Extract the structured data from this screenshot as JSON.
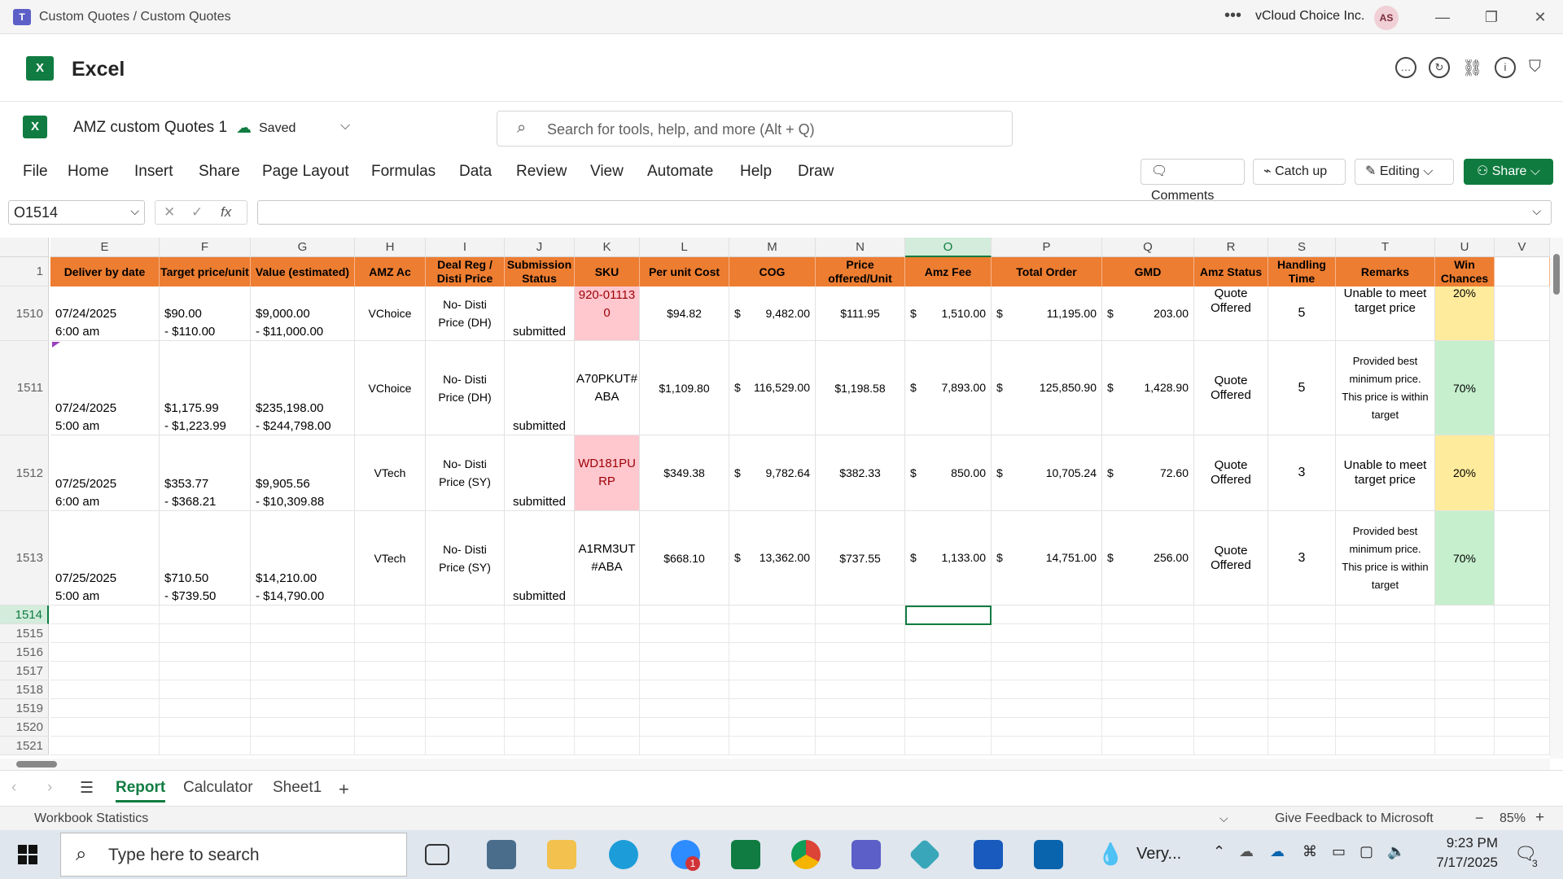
{
  "window": {
    "title": "Custom Quotes / Custom Quotes",
    "org": "vCloud Choice Inc.",
    "avatar": "AS"
  },
  "app": {
    "name": "Excel"
  },
  "doc": {
    "name": "AMZ custom Quotes 1",
    "status": "Saved"
  },
  "search": {
    "placeholder": "Search for tools, help, and more (Alt + Q)"
  },
  "menu": [
    "File",
    "Home",
    "Insert",
    "Share",
    "Page Layout",
    "Formulas",
    "Data",
    "Review",
    "View",
    "Automate",
    "Help",
    "Draw"
  ],
  "ribbon_buttons": {
    "comments": "Comments",
    "catchup": "Catch up",
    "editing": "Editing",
    "share": "Share"
  },
  "formula_bar": {
    "name_box": "O1514",
    "fx": "fx",
    "content": ""
  },
  "columns": [
    "E",
    "F",
    "G",
    "H",
    "I",
    "J",
    "K",
    "L",
    "M",
    "N",
    "O",
    "P",
    "Q",
    "R",
    "S",
    "T",
    "U",
    "V"
  ],
  "header_row_num": "1",
  "headers": [
    "Deliver by date",
    "Target price/unit",
    "Value (estimated)",
    "AMZ Ac",
    "Deal Reg / Disti Price",
    "Submission Status",
    "SKU",
    "Per unit Cost",
    "COG",
    "Price offered/Unit",
    "Amz Fee",
    "Total Order",
    "GMD",
    "Amz Status",
    "Handling Time",
    "Remarks",
    "Win Chances"
  ],
  "rows": [
    {
      "num": "1510",
      "date1": "07/24/2025",
      "date2": "6:00 am",
      "tp1": "$90.00",
      "tp2": "- $110.00",
      "v1": "$9,000.00",
      "v2": "- $11,000.00",
      "ac": "VChoice",
      "deal": "No- Disti Price (DH)",
      "sub": "submitted",
      "sku": "920-01113 0",
      "cost": "$94.82",
      "cog": "9,482.00",
      "offer": "$111.95",
      "fee": "1,510.00",
      "total": "11,195.00",
      "gmd": "203.00",
      "status": "Quote Offered",
      "handling": "5",
      "remarks": "Unable to meet target price",
      "win": "20%"
    },
    {
      "num": "1511",
      "date1": "07/24/2025",
      "date2": "5:00 am",
      "tp1": "$1,175.99",
      "tp2": "- $1,223.99",
      "v1": "$235,198.00",
      "v2": "- $244,798.00",
      "ac": "VChoice",
      "deal": "No- Disti Price (DH)",
      "sub": "submitted",
      "sku": "A70PKUT# ABA",
      "cost": "$1,109.80",
      "cog": "116,529.00",
      "offer": "$1,198.58",
      "fee": "7,893.00",
      "total": "125,850.90",
      "gmd": "1,428.90",
      "status": "Quote Offered",
      "handling": "5",
      "remarks": "Provided best minimum price. This price is within target",
      "win": "70%"
    },
    {
      "num": "1512",
      "date1": "07/25/2025",
      "date2": "6:00 am",
      "tp1": "$353.77",
      "tp2": "- $368.21",
      "v1": "$9,905.56",
      "v2": "- $10,309.88",
      "ac": "VTech",
      "deal": "No- Disti Price (SY)",
      "sub": "submitted",
      "sku": "WD181PU RP",
      "cost": "$349.38",
      "cog": "9,782.64",
      "offer": "$382.33",
      "fee": "850.00",
      "total": "10,705.24",
      "gmd": "72.60",
      "status": "Quote Offered",
      "handling": "3",
      "remarks": "Unable to meet target price",
      "win": "20%"
    },
    {
      "num": "1513",
      "date1": "07/25/2025",
      "date2": "5:00 am",
      "tp1": "$710.50",
      "tp2": "- $739.50",
      "v1": "$14,210.00",
      "v2": "- $14,790.00",
      "ac": "VTech",
      "deal": "No- Disti Price (SY)",
      "sub": "submitted",
      "sku": "A1RM3UT #ABA",
      "cost": "$668.10",
      "cog": "13,362.00",
      "offer": "$737.55",
      "fee": "1,133.00",
      "total": "14,751.00",
      "gmd": "256.00",
      "status": "Quote Offered",
      "handling": "3",
      "remarks": "Provided best minimum price. This price is within target",
      "win": "70%"
    }
  ],
  "empty_rows": [
    "1514",
    "1515",
    "1516",
    "1517",
    "1518",
    "1519",
    "1520",
    "1521"
  ],
  "dollar": "$",
  "sheets": [
    "Report",
    "Calculator",
    "Sheet1"
  ],
  "statusbar": {
    "left": "Workbook Statistics",
    "feedback": "Give Feedback to Microsoft",
    "zoom": "85%"
  },
  "taskbar": {
    "search_placeholder": "Type here to search",
    "weather": "Very...",
    "time": "9:23 PM",
    "date": "7/17/2025",
    "notifications": "3",
    "zoom_badge": "1"
  },
  "colors": {
    "header_orange": "#ed7d31",
    "excel_green": "#107c41",
    "pink": "#ffc7ce",
    "yellow": "#ffeb9c",
    "green": "#c6efce"
  }
}
